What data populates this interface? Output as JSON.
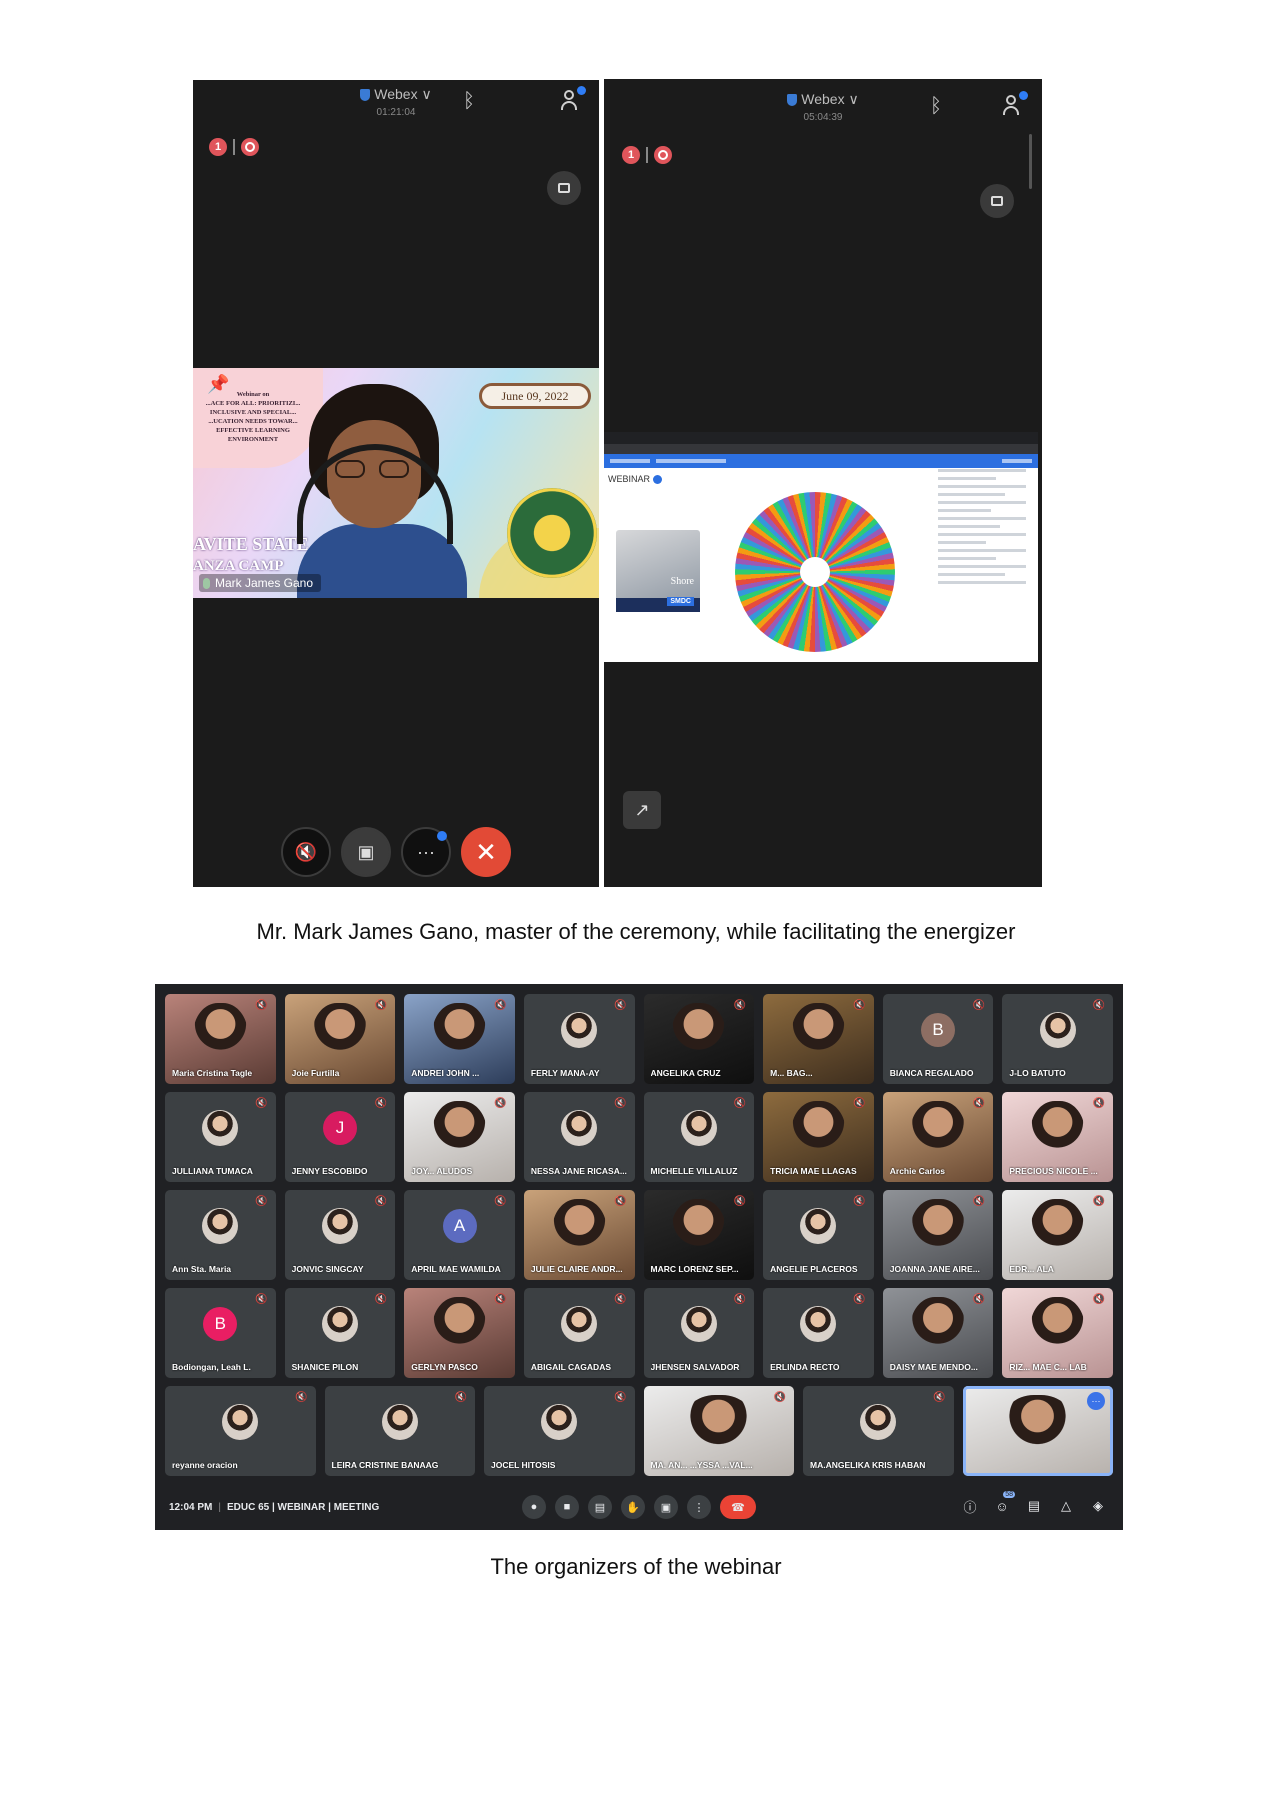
{
  "captions": {
    "first": "Mr. Mark James Gano, master of the ceremony, while facilitating the energizer",
    "second": "The organizers of the webinar"
  },
  "left_phone": {
    "app_name": "Webex ∨",
    "timer": "01:21:04",
    "badge_count": "1",
    "shared_slide": {
      "webinar_label": "Webinar on",
      "title": "...ACE FOR ALL: PRIORITIZI... INCLUSIVE AND SPECIAL... ...UCATION NEEDS TOWAR... EFFECTIVE LEARNING ENVIRONMENT",
      "date": "June 09, 2022",
      "campus_line1": "AVITE STATE",
      "campus_line2": "ANZA CAMP"
    },
    "presenter_name": "Mark James Gano",
    "controls": {
      "more_label": "···",
      "end_label": "✕"
    }
  },
  "right_phone": {
    "app_name": "Webex ∨",
    "timer": "05:04:39",
    "badge_count": "1",
    "shared_screen": {
      "page_label": "WEBINAR",
      "ad_text": "Shore",
      "ad_brand": "SMDC"
    }
  },
  "meeting": {
    "time": "12:04 PM",
    "separator": "|",
    "title": "EDUC 65 | WEBINAR | MEETING",
    "participant_count": "58",
    "participants": [
      {
        "name": "Maria Cristina Tagle",
        "kind": "video",
        "tone": "rose"
      },
      {
        "name": "Joie Furtilla",
        "kind": "video",
        "tone": "warm"
      },
      {
        "name": "ANDREI JOHN ...",
        "kind": "video",
        "tone": "blue"
      },
      {
        "name": "FERLY MANA-AY",
        "kind": "avatar"
      },
      {
        "name": "ANGELIKA CRUZ",
        "kind": "video",
        "tone": "dark"
      },
      {
        "name": "M... BAG...",
        "kind": "video",
        "tone": "gold"
      },
      {
        "name": "BIANCA REGALADO",
        "kind": "letter",
        "letter": "B",
        "color": "#8d6e63"
      },
      {
        "name": "J-LO BATUTO",
        "kind": "avatar"
      },
      {
        "name": "JULLIANA TUMACA",
        "kind": "avatar"
      },
      {
        "name": "JENNY ESCOBIDO",
        "kind": "letter",
        "letter": "J",
        "color": "#d81b60"
      },
      {
        "name": "JOY... ALUDOS",
        "kind": "video",
        "tone": "white"
      },
      {
        "name": "NESSA JANE RICASA...",
        "kind": "avatar"
      },
      {
        "name": "MICHELLE VILLALUZ",
        "kind": "avatar"
      },
      {
        "name": "TRICIA MAE LLAGAS",
        "kind": "video",
        "tone": "gold"
      },
      {
        "name": "Archie Carlos",
        "kind": "video",
        "tone": "warm"
      },
      {
        "name": "PRECIOUS NICOLE ...",
        "kind": "video",
        "tone": "pink"
      },
      {
        "name": "Ann Sta. Maria",
        "kind": "avatar"
      },
      {
        "name": "JONVIC SINGCAY",
        "kind": "avatar"
      },
      {
        "name": "APRIL MAE WAMILDA",
        "kind": "letter",
        "letter": "A",
        "color": "#5c6bc0"
      },
      {
        "name": "JULIE CLAIRE ANDR...",
        "kind": "video",
        "tone": "warm"
      },
      {
        "name": "MARC LORENZ SEP...",
        "kind": "video",
        "tone": "dark"
      },
      {
        "name": "ANGELIE PLACEROS",
        "kind": "avatar"
      },
      {
        "name": "JOANNA JANE AIRE...",
        "kind": "video",
        "tone": "grey"
      },
      {
        "name": "EDR... ALA",
        "kind": "video",
        "tone": "white"
      },
      {
        "name": "Bodiongan, Leah L.",
        "kind": "letter",
        "letter": "B",
        "color": "#e91e63"
      },
      {
        "name": "SHANICE PILON",
        "kind": "avatar"
      },
      {
        "name": "GERLYN PASCO",
        "kind": "video",
        "tone": "rose"
      },
      {
        "name": "ABIGAIL CAGADAS",
        "kind": "avatar"
      },
      {
        "name": "JHENSEN SALVADOR",
        "kind": "avatar"
      },
      {
        "name": "ERLINDA RECTO",
        "kind": "avatar"
      },
      {
        "name": "DAISY MAE MENDO...",
        "kind": "video",
        "tone": "grey"
      },
      {
        "name": "RIZ... MAE C... LAB",
        "kind": "video",
        "tone": "pink"
      },
      {
        "name": "reyanne oracion",
        "kind": "avatar"
      },
      {
        "name": "LEIRA CRISTINE BANAAG",
        "kind": "avatar"
      },
      {
        "name": "JOCEL HITOSIS",
        "kind": "avatar"
      },
      {
        "name": "MA. AN... ...YSSA ...VAL...",
        "kind": "video",
        "tone": "white"
      },
      {
        "name": "MA.ANGELIKA KRIS HABAN",
        "kind": "avatar"
      },
      {
        "name": "",
        "kind": "video",
        "tone": "white",
        "active": true
      }
    ]
  }
}
